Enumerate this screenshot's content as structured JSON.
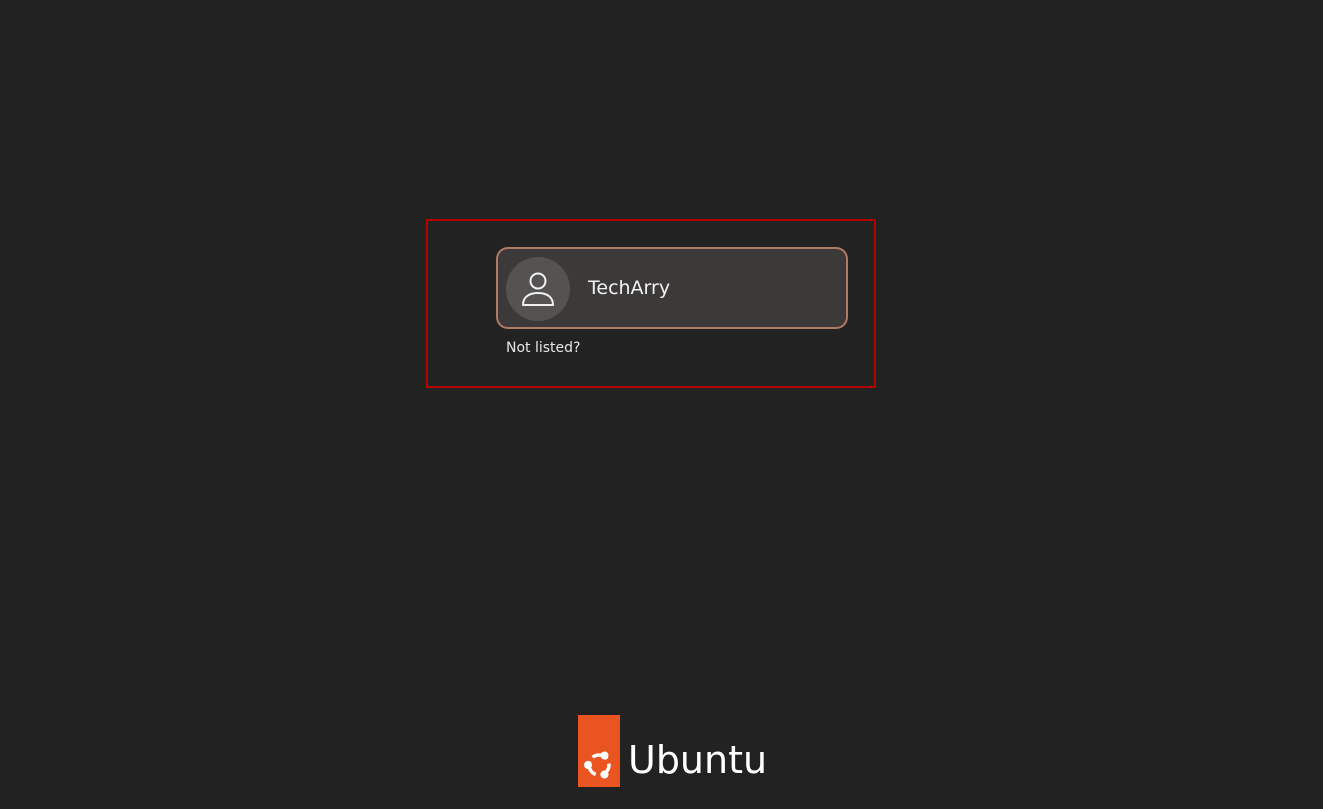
{
  "login": {
    "users": [
      {
        "name": "TechArry",
        "avatar_icon": "person-icon"
      }
    ],
    "not_listed_label": "Not listed?"
  },
  "branding": {
    "logo_text": "Ubuntu",
    "logo_icon": "ubuntu-circle-of-friends-icon",
    "accent_color": "#e95420"
  },
  "colors": {
    "background": "#222222",
    "card_background": "#3c3939",
    "card_border": "#b07a63",
    "highlight_border": "#b30000"
  }
}
